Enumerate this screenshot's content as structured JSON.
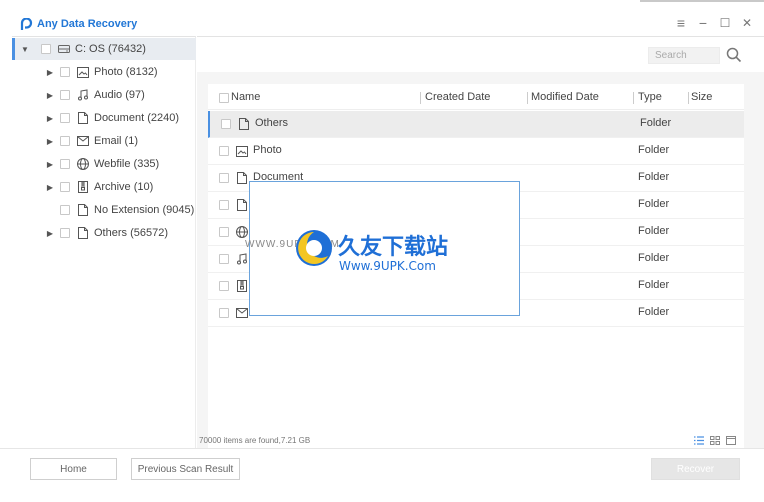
{
  "app": {
    "title": "Any Data Recovery"
  },
  "window_controls": {
    "menu": "≡",
    "minimize": "−",
    "maximize": "☐",
    "close": "✕"
  },
  "sidebar": {
    "root": {
      "label": "C: OS (76432)"
    },
    "items": [
      {
        "label": "Photo (8132)",
        "icon": "image-icon"
      },
      {
        "label": "Audio (97)",
        "icon": "music-icon"
      },
      {
        "label": "Document (2240)",
        "icon": "document-icon"
      },
      {
        "label": "Email (1)",
        "icon": "mail-icon"
      },
      {
        "label": "Webfile (335)",
        "icon": "globe-icon"
      },
      {
        "label": "Archive (10)",
        "icon": "archive-icon"
      },
      {
        "label": "No Extension (9045)",
        "icon": "file-icon"
      },
      {
        "label": "Others (56572)",
        "icon": "file-icon"
      }
    ]
  },
  "search": {
    "placeholder": "Search"
  },
  "table": {
    "columns": [
      "Name",
      "Created Date",
      "Modified Date",
      "Type",
      "Size"
    ],
    "rows": [
      {
        "name": "Others",
        "type": "Folder",
        "icon": "file-icon"
      },
      {
        "name": "Photo",
        "type": "Folder",
        "icon": "image-icon"
      },
      {
        "name": "Document",
        "type": "Folder",
        "icon": "document-icon"
      },
      {
        "name": "",
        "type": "Folder",
        "icon": "document-icon"
      },
      {
        "name": "",
        "type": "Folder",
        "icon": "globe-icon"
      },
      {
        "name": "",
        "type": "Folder",
        "icon": "music-icon"
      },
      {
        "name": "",
        "type": "Folder",
        "icon": "archive-icon"
      },
      {
        "name": "Email",
        "type": "Folder",
        "icon": "mail-icon"
      }
    ]
  },
  "status": {
    "text": "70000 items are found,7.21 GB"
  },
  "buttons": {
    "home": "Home",
    "previous_scan": "Previous Scan Result",
    "recover": "Recover"
  },
  "watermark": {
    "url": "WWW.9UPK.COM",
    "title": "久友下载站",
    "subtitle": "Www.9UPK.Com"
  },
  "colors": {
    "accent": "#4a90e2",
    "brand": "#2277d6"
  }
}
